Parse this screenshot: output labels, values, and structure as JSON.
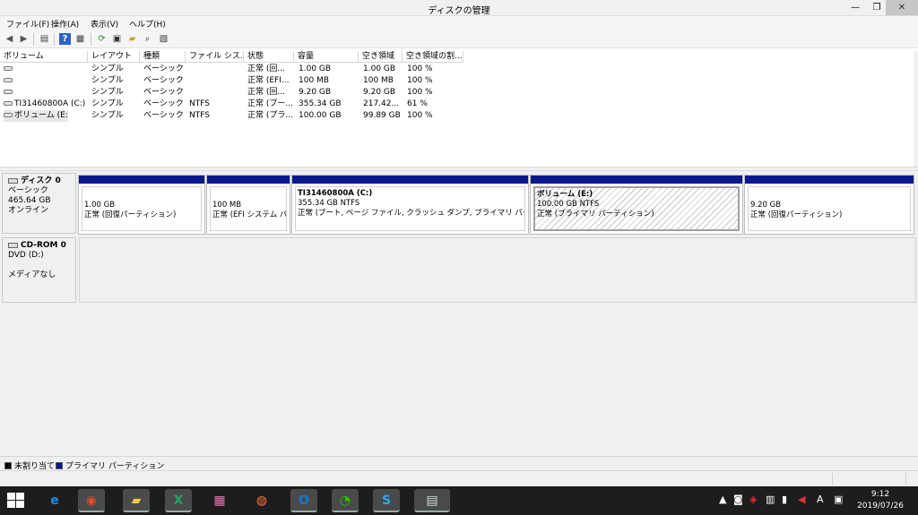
{
  "window": {
    "title": "ディスクの管理",
    "min_glyph": "—",
    "max_glyph": "❐",
    "close_glyph": "✕"
  },
  "menu": {
    "file": "ファイル(F)",
    "action": "操作(A)",
    "view": "表示(V)",
    "help": "ヘルプ(H)"
  },
  "toolbar": {
    "back_icon": "◀",
    "forward_icon": "▶",
    "list_icon": "▤",
    "help_icon": "?",
    "panel_icon": "▦",
    "refresh_icon": "⟳",
    "rescan_icon": "▣",
    "folder_icon": "▰",
    "search_icon": "⌕",
    "properties_icon": "▧"
  },
  "volumes": {
    "headers": [
      "ボリューム",
      "レイアウト",
      "種類",
      "ファイル シス...",
      "状態",
      "容量",
      "空き領域",
      "空き領域の割..."
    ],
    "rows": [
      {
        "name": "",
        "layout": "シンプル",
        "type": "ベーシック",
        "fs": "",
        "status": "正常 (回...",
        "capacity": "1.00 GB",
        "free": "1.00 GB",
        "pct": "100 %"
      },
      {
        "name": "",
        "layout": "シンプル",
        "type": "ベーシック",
        "fs": "",
        "status": "正常 (EFI...",
        "capacity": "100 MB",
        "free": "100 MB",
        "pct": "100 %"
      },
      {
        "name": "",
        "layout": "シンプル",
        "type": "ベーシック",
        "fs": "",
        "status": "正常 (回...",
        "capacity": "9.20 GB",
        "free": "9.20 GB",
        "pct": "100 %"
      },
      {
        "name": "TI31460800A (C:)",
        "layout": "シンプル",
        "type": "ベーシック",
        "fs": "NTFS",
        "status": "正常 (ブー...",
        "capacity": "355.34 GB",
        "free": "217.42...",
        "pct": "61 %"
      },
      {
        "name": "ボリューム (E:)",
        "layout": "シンプル",
        "type": "ベーシック",
        "fs": "NTFS",
        "status": "正常 (プラ...",
        "capacity": "100.00 GB",
        "free": "99.89 GB",
        "pct": "100 %"
      }
    ]
  },
  "disk0": {
    "name": "ディスク 0",
    "type": "ベーシック",
    "size": "465.64 GB",
    "state": "オンライン",
    "partitions": [
      {
        "name": "",
        "size": "1.00 GB",
        "status": "正常 (回復パーティション)"
      },
      {
        "name": "",
        "size": "100 MB",
        "status": "正常 (EFI システム パ"
      },
      {
        "name": "TI31460800A  (C:)",
        "size": "355.34 GB NTFS",
        "status": "正常 (ブート, ページ ファイル, クラッシュ ダンプ, プライマリ パーティション)"
      },
      {
        "name": "ボリューム  (E:)",
        "size": "100.00 GB NTFS",
        "status": "正常 (プライマリ パーティション)"
      },
      {
        "name": "",
        "size": "9.20 GB",
        "status": "正常 (回復パーティション)"
      }
    ]
  },
  "cdrom0": {
    "name": "CD-ROM 0",
    "drive": "DVD (D:)",
    "media": "メディアなし"
  },
  "legend": {
    "unallocated": "未割り当て",
    "primary": "プライマリ パーティション",
    "unallocated_color": "#000000",
    "primary_color": "#0a1a8c"
  },
  "taskbar": {
    "apps": [
      {
        "icon": "ie-icon",
        "glyph": "e",
        "color": "#1f8fe0"
      },
      {
        "icon": "chrome-icon",
        "glyph": "◉",
        "color": "#e34c26"
      },
      {
        "icon": "explorer-icon",
        "glyph": "▰",
        "color": "#f2c744"
      },
      {
        "icon": "excel-icon",
        "glyph": "X",
        "color": "#21a366"
      },
      {
        "icon": "paint-icon",
        "glyph": "▦",
        "color": "#e879b5"
      },
      {
        "icon": "firefox-icon",
        "glyph": "◍",
        "color": "#ff7139"
      },
      {
        "icon": "outlook-icon",
        "glyph": "O",
        "color": "#1478d4"
      },
      {
        "icon": "wechat-icon",
        "glyph": "◔",
        "color": "#2dc100"
      },
      {
        "icon": "skype-icon",
        "glyph": "S",
        "color": "#2aa9ef"
      },
      {
        "icon": "disk-management-icon",
        "glyph": "▤",
        "color": "#cfd8dc"
      }
    ],
    "tray": {
      "ime": "A",
      "time": "9:12",
      "date": "2019/07/26"
    }
  }
}
